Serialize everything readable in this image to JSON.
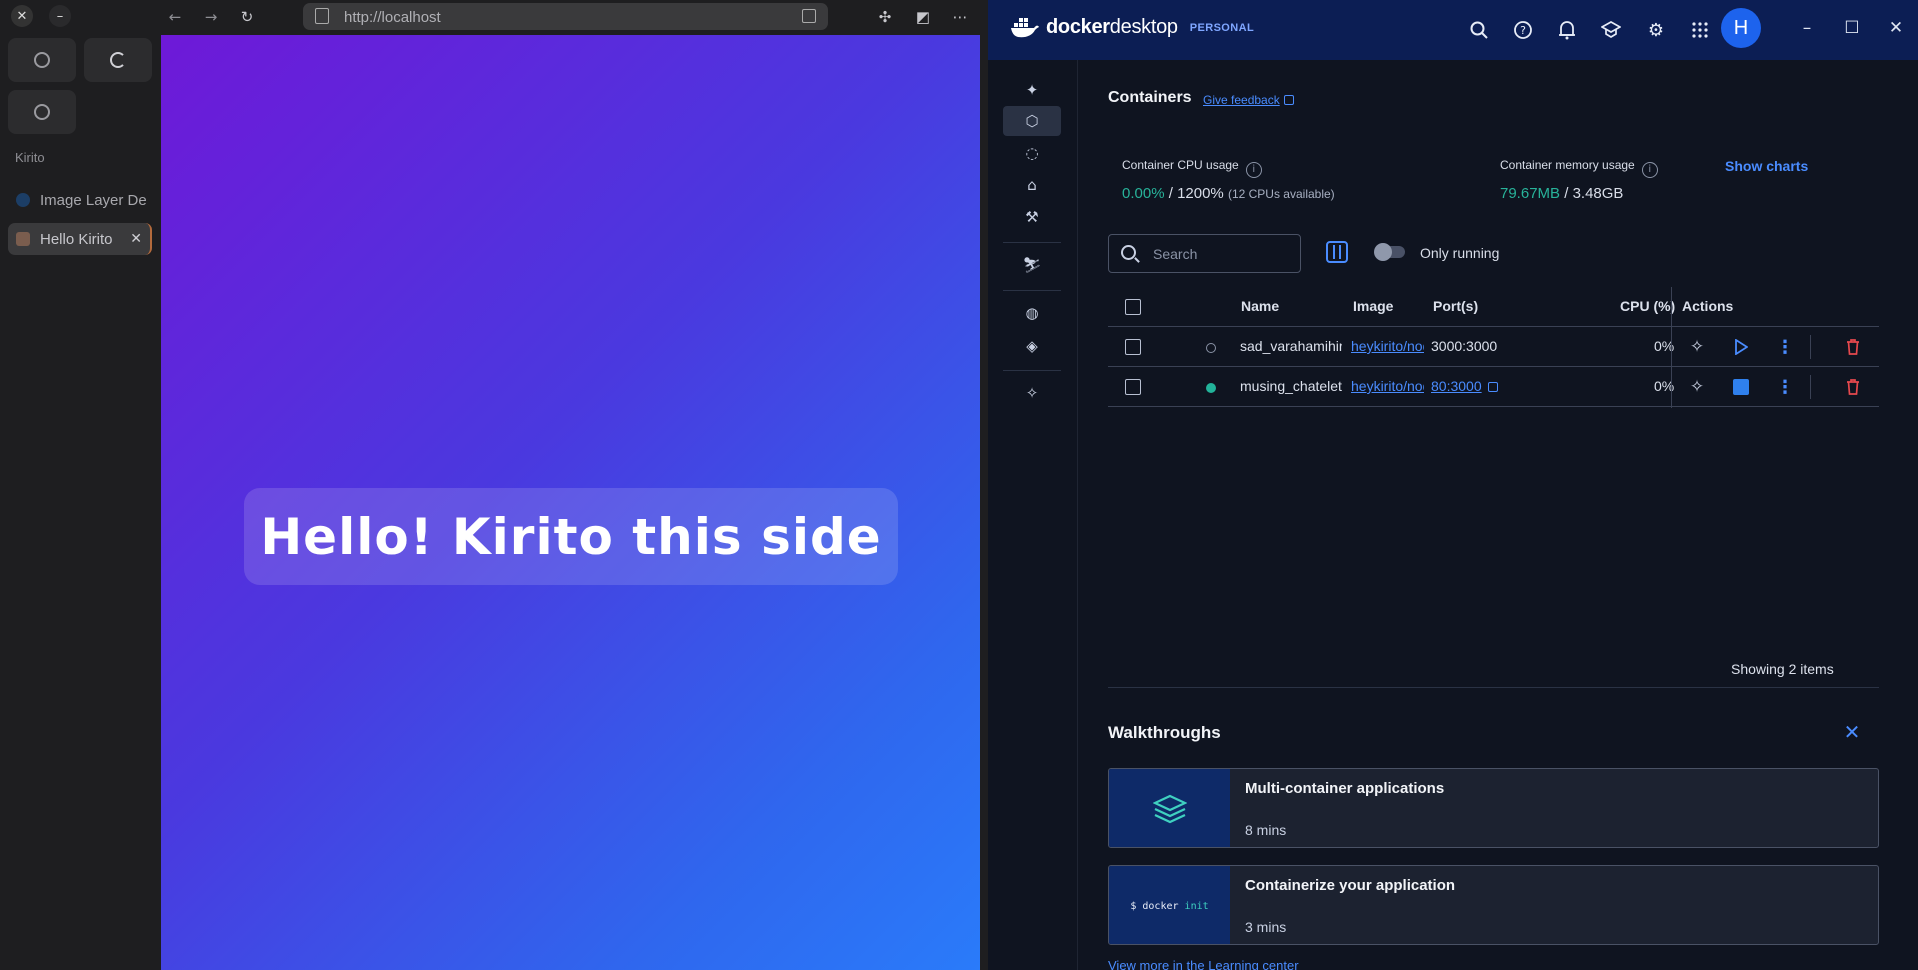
{
  "browser": {
    "url": "http://localhost",
    "sidebar": {
      "section_label": "Kirito",
      "tabs": [
        {
          "label": "Image Layer De",
          "active": false
        },
        {
          "label": "Hello Kirito",
          "active": true
        }
      ]
    },
    "page": {
      "heading": "Hello! Kirito this side",
      "gradient": [
        "#6e19d8",
        "#2a7bfa"
      ]
    }
  },
  "docker": {
    "brand": {
      "name_bold": "docker",
      "name_light": "desktop",
      "plan": "PERSONAL"
    },
    "avatar_initial": "H",
    "page_title": "Containers",
    "feedback_label": "Give feedback",
    "cpu": {
      "label": "Container CPU usage",
      "used": "0.00%",
      "sep": " / ",
      "total": "1200%",
      "note": "(12 CPUs available)"
    },
    "memory": {
      "label": "Container memory usage",
      "used": "79.67MB",
      "sep": " / ",
      "total": "3.48GB"
    },
    "show_charts": "Show charts",
    "search_placeholder": "Search",
    "only_running": "Only running",
    "columns": {
      "name": "Name",
      "image": "Image",
      "ports": "Port(s)",
      "cpu": "CPU (%)",
      "actions": "Actions"
    },
    "containers": [
      {
        "name": "sad_varahamihir",
        "image": "heykirito/node",
        "ports": "3000:3000",
        "ports_link": false,
        "cpu": "0%",
        "status": "stopped"
      },
      {
        "name": "musing_chatelet",
        "image": "heykirito/node",
        "ports": "80:3000",
        "ports_link": true,
        "cpu": "0%",
        "status": "running"
      }
    ],
    "showing": "Showing 2 items",
    "walkthroughs": {
      "title": "Walkthroughs",
      "items": [
        {
          "title": "Multi-container applications",
          "duration": "8 mins"
        },
        {
          "title": "Containerize your application",
          "duration": "3 mins",
          "code_prefix": "$ docker",
          "code_cmd": "init"
        }
      ],
      "more": "View more in the Learning center"
    },
    "colors": {
      "accent": "#4a8cff",
      "header": "#0c1e54",
      "running": "#22b39a",
      "delete": "#e5484d"
    }
  }
}
